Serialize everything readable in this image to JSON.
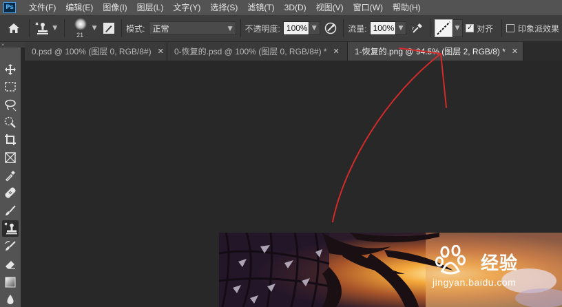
{
  "app": {
    "logo_text": "Ps"
  },
  "menubar": {
    "items": [
      "文件(F)",
      "编辑(E)",
      "图像(I)",
      "图层(L)",
      "文字(Y)",
      "选择(S)",
      "滤镜(T)",
      "3D(D)",
      "视图(V)",
      "窗口(W)",
      "帮助(H)"
    ]
  },
  "options": {
    "brush_size": "21",
    "mode_label": "模式:",
    "mode_value": "正常",
    "opacity_label": "不透明度:",
    "opacity_value": "100%",
    "flow_label": "流量:",
    "flow_value": "100%",
    "align_label": "对齐",
    "align_checked": true,
    "impressionist_label": "印象派效果",
    "impressionist_checked": false
  },
  "panel": {
    "collapse_glyph": "»"
  },
  "tabs": [
    {
      "label": "0.psd @ 100% (图层 0, RGB/8#)",
      "close": "✕",
      "active": false
    },
    {
      "label": "0-恢复的.psd @ 100% (图层 0, RGB/8#) *",
      "close": "✕",
      "active": false
    },
    {
      "label": "1-恢复的.png @ 94.5% (图层 2, RGB/8) *",
      "close": "✕",
      "active": true
    }
  ],
  "tools": [
    "move-icon",
    "marquee-icon",
    "lasso-icon",
    "quick-select-icon",
    "crop-icon",
    "frame-icon",
    "eyedropper-icon",
    "healing-icon",
    "brush-icon",
    "clone-stamp-icon",
    "history-brush-icon",
    "eraser-icon",
    "gradient-icon",
    "blur-icon"
  ],
  "watermark": {
    "brand": "经验",
    "url": "jingyan.baidu.com",
    "logo": "Bai du paw logo"
  },
  "colors": {
    "menubar": "#535353",
    "optionsbar": "#3d3d3d",
    "workspace": "#282828",
    "annotation": "#d42a2a"
  }
}
